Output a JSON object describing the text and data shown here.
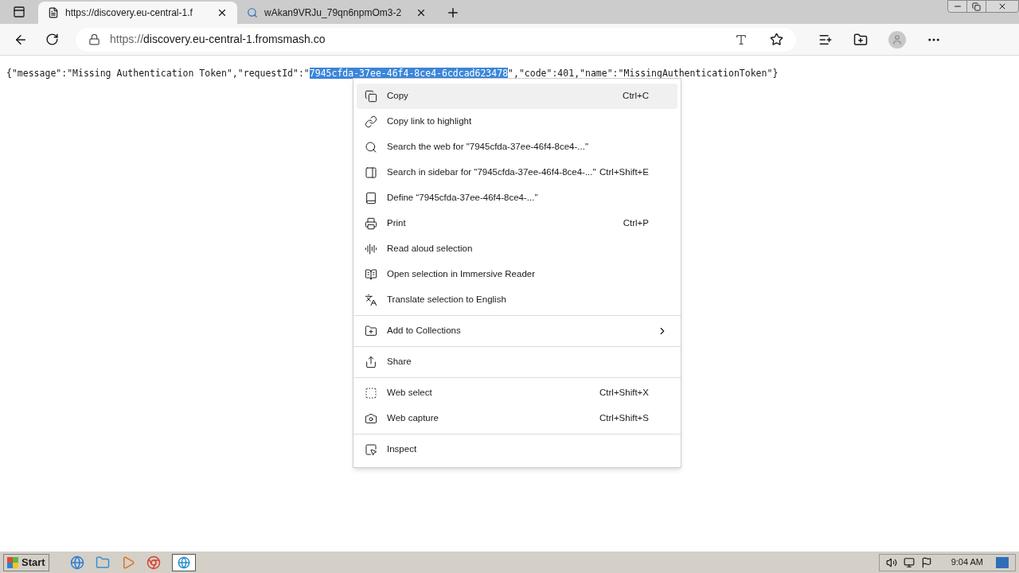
{
  "tabs": [
    {
      "title": "https://discovery.eu-central-1.f",
      "selected": true,
      "kind": "page"
    },
    {
      "title": "wAkan9VRJu_79qn6npmOm3-2",
      "selected": false,
      "kind": "search"
    }
  ],
  "address_bar": {
    "scheme": "https://",
    "host": "discovery.eu-central-1.fromsmash.co"
  },
  "page": {
    "before": "{\"message\":\"Missing Authentication Token\",\"requestId\":\"",
    "selection": "7945cfda-37ee-46f4-8ce4-6cdcad623478",
    "after": "\",\"code\":401,\"name\":\"MissingAuthenticationToken\"}"
  },
  "context_menu": {
    "groups": [
      {
        "items": [
          {
            "label": "Copy",
            "shortcut": "Ctrl+C",
            "selected": true
          },
          {
            "label": "Copy link to highlight",
            "selected": false
          },
          {
            "label": "Search the web for \"7945cfda-37ee-46f4-8ce4-...\"",
            "selected": false
          },
          {
            "label": "Search in sidebar for \"7945cfda-37ee-46f4-8ce4-...\"",
            "shortcut": "Ctrl+Shift+E",
            "selected": false
          },
          {
            "label": "Define “7945cfda-37ee-46f4-8ce4-...”",
            "selected": false
          },
          {
            "label": "Print",
            "shortcut": "Ctrl+P",
            "selected": false
          },
          {
            "label": "Read aloud selection",
            "selected": false
          },
          {
            "label": "Open selection in Immersive Reader",
            "selected": false
          },
          {
            "label": "Translate selection to English",
            "selected": false
          }
        ]
      },
      {
        "items": [
          {
            "label": "Add to Collections",
            "submenu": true,
            "selected": false
          }
        ]
      },
      {
        "items": [
          {
            "label": "Share",
            "selected": false
          }
        ]
      },
      {
        "items": [
          {
            "label": "Web select",
            "shortcut": "Ctrl+Shift+X",
            "selected": false
          },
          {
            "label": "Web capture",
            "shortcut": "Ctrl+Shift+S",
            "selected": false
          }
        ]
      },
      {
        "items": [
          {
            "label": "Inspect",
            "selected": false
          }
        ]
      }
    ]
  },
  "taskbar": {
    "start": "Start",
    "clock": "9:04 AM"
  }
}
